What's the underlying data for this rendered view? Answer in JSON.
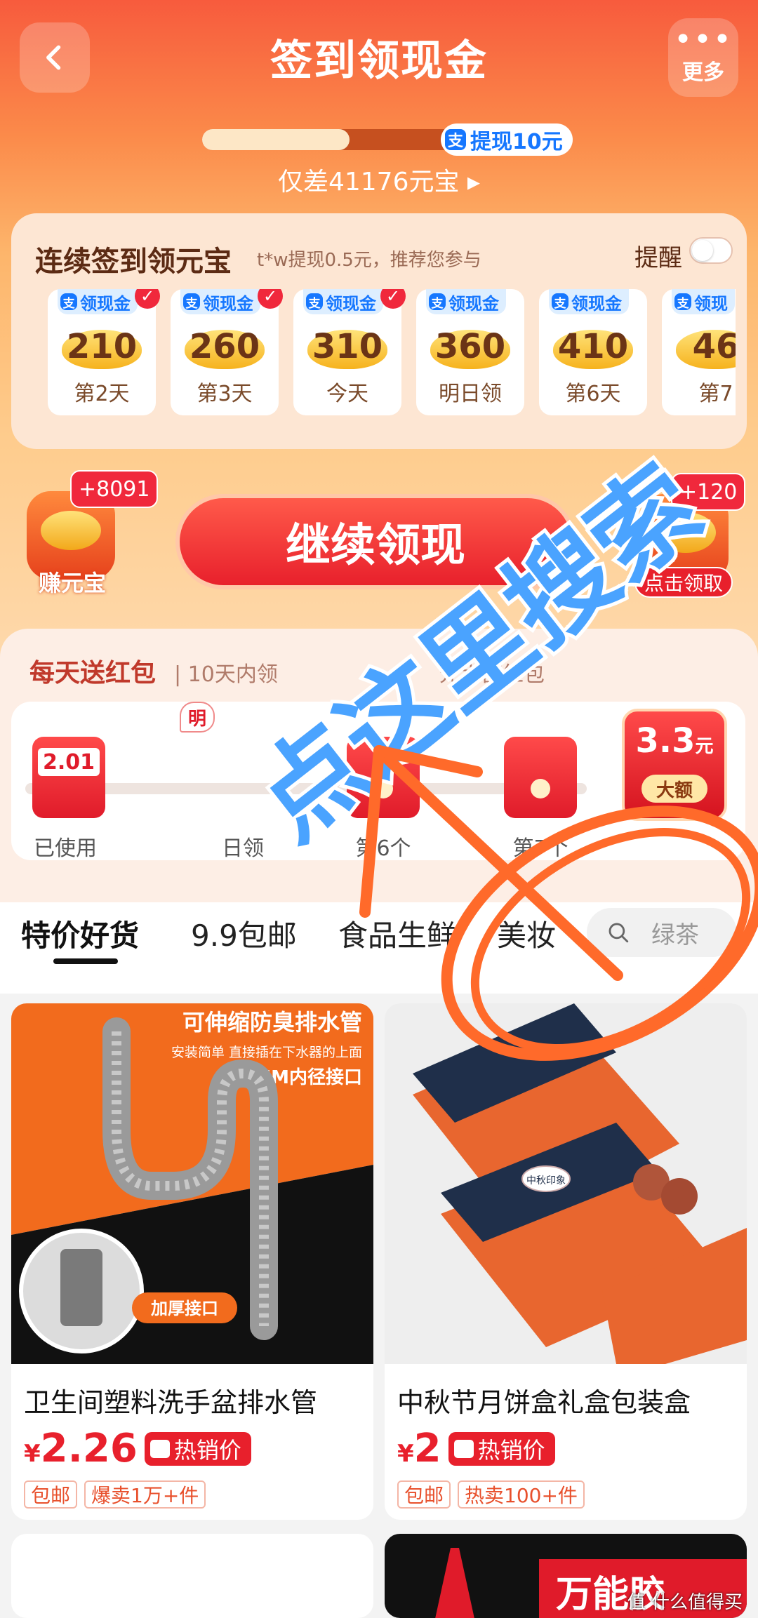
{
  "header": {
    "title": "签到领现金",
    "more_label": "更多",
    "more_dots": "•••"
  },
  "progress": {
    "badge": "提现10元",
    "subtitle": "仅差41176元宝 ▸",
    "fill_fraction": 0.5
  },
  "alipay_mark": "支",
  "checkin": {
    "title": "连续签到领元宝",
    "desc": "t*w提现0.5元，推荐您参与",
    "remind_label": "提醒",
    "days": [
      {
        "badge": "领现金",
        "value": "210",
        "label": "第2天",
        "checked": true
      },
      {
        "badge": "领现金",
        "value": "260",
        "label": "第3天",
        "checked": true
      },
      {
        "badge": "领现金",
        "value": "310",
        "label": "今天",
        "checked": true
      },
      {
        "badge": "领现金",
        "value": "360",
        "label": "明日领",
        "checked": false
      },
      {
        "badge": "领现金",
        "value": "410",
        "label": "第6天",
        "checked": false
      },
      {
        "badge": "领现",
        "value": "46",
        "label": "第7",
        "checked": false
      }
    ]
  },
  "actions": {
    "earn_label": "赚元宝",
    "earn_badge": "+8091",
    "main_button": "继续领现",
    "claim_label": "点击领取",
    "claim_badge": "+120"
  },
  "redpack": {
    "title": "每天送红包",
    "desc": "| 10天内领",
    "desc_tail": "元大额红包",
    "tomorrow_tag": "明",
    "items": [
      {
        "value": "2.01",
        "label": "已使用"
      },
      {
        "value": "",
        "label": "日领"
      },
      {
        "value": "",
        "label": "第6个"
      },
      {
        "value": "",
        "label": "第7个"
      }
    ],
    "big": {
      "value": "3.3",
      "unit": "元",
      "tag": "大额"
    }
  },
  "tabs": [
    {
      "label": "特价好货",
      "active": true
    },
    {
      "label": "9.9包邮",
      "active": false
    },
    {
      "label": "食品生鲜",
      "active": false
    },
    {
      "label": "美妆",
      "active": false
    }
  ],
  "search": {
    "placeholder": "绿茶"
  },
  "products": [
    {
      "name": "卫生间塑料洗手盆排水管",
      "price_symbol": "¥",
      "price": "2.26",
      "hot_tag": "热销价",
      "tags": [
        "包邮",
        "爆卖1万+件"
      ],
      "img_title": "可伸缩防臭排水管",
      "img_sub": "安装简单 直接插在下水器的上面",
      "img_sub2": "26MM内径接口",
      "img_badge": "加厚接口"
    },
    {
      "name": "中秋节月饼盒礼盒包装盒",
      "price_symbol": "¥",
      "price": "2",
      "hot_tag": "热销价",
      "tags": [
        "包邮",
        "热卖100+件"
      ],
      "img_logo": "中秋印象"
    }
  ],
  "bottom_card": {
    "banner": "万能胶"
  },
  "watermark": "值 什么值得买",
  "overlay_text": "点这里搜索",
  "colors": {
    "brand_red": "#e8202c",
    "header_orange": "#f75b3d",
    "alipay_blue": "#1677ff",
    "overlay_blue": "#4aa3ff",
    "annotation_orange": "#ff6a2a"
  }
}
